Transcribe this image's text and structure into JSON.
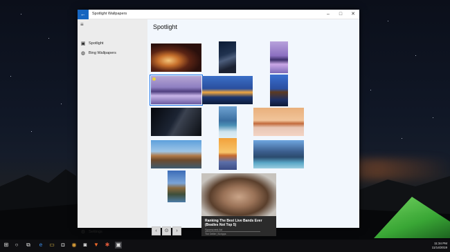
{
  "window": {
    "title": "Spotlight Wallpapers",
    "back_glyph": "←",
    "controls": {
      "minimize": "–",
      "maximize": "□",
      "close": "✕"
    }
  },
  "sidebar": {
    "menu_glyph": "≡",
    "items": [
      {
        "label": "Spotlight",
        "icon": "spotlight-icon",
        "glyph": "▣"
      },
      {
        "label": "Bing Wallpapers",
        "icon": "globe-icon",
        "glyph": "◍"
      }
    ],
    "settings": {
      "label": "Settings",
      "icon": "gear-icon",
      "glyph": "⚙"
    }
  },
  "main": {
    "title": "Spotlight",
    "selected_wallpaper": "lake-rocks-landscape",
    "ad": {
      "title": "Ranking The Best Live Bands Ever (Beatles Not Top 5)",
      "source": "Sponsored Ad",
      "brand": "The Delite | Scripps"
    },
    "pager": {
      "prev": "‹",
      "home": "⊙",
      "next": "›"
    }
  },
  "taskbar": {
    "start_glyph": "⊞",
    "icons": [
      {
        "name": "search-icon",
        "glyph": "○"
      },
      {
        "name": "task-view-icon",
        "glyph": "⧉"
      },
      {
        "name": "edge-icon",
        "glyph": "e"
      },
      {
        "name": "file-explorer-icon",
        "glyph": "▭"
      },
      {
        "name": "store-icon",
        "glyph": "◘"
      },
      {
        "name": "chrome-icon",
        "glyph": "◉"
      },
      {
        "name": "camera-icon",
        "glyph": "◙"
      },
      {
        "name": "brave-icon",
        "glyph": "▼"
      },
      {
        "name": "app-icon",
        "glyph": "✱"
      },
      {
        "name": "spotlight-app-icon",
        "glyph": "▣"
      }
    ],
    "time": "11:34 PM",
    "date": "11/14/2019"
  },
  "colors": {
    "accent": "#1565c0",
    "sidebar_bg": "#ececec",
    "main_bg": "#f2f7fd",
    "taskbar_bg": "#0f0f12"
  }
}
